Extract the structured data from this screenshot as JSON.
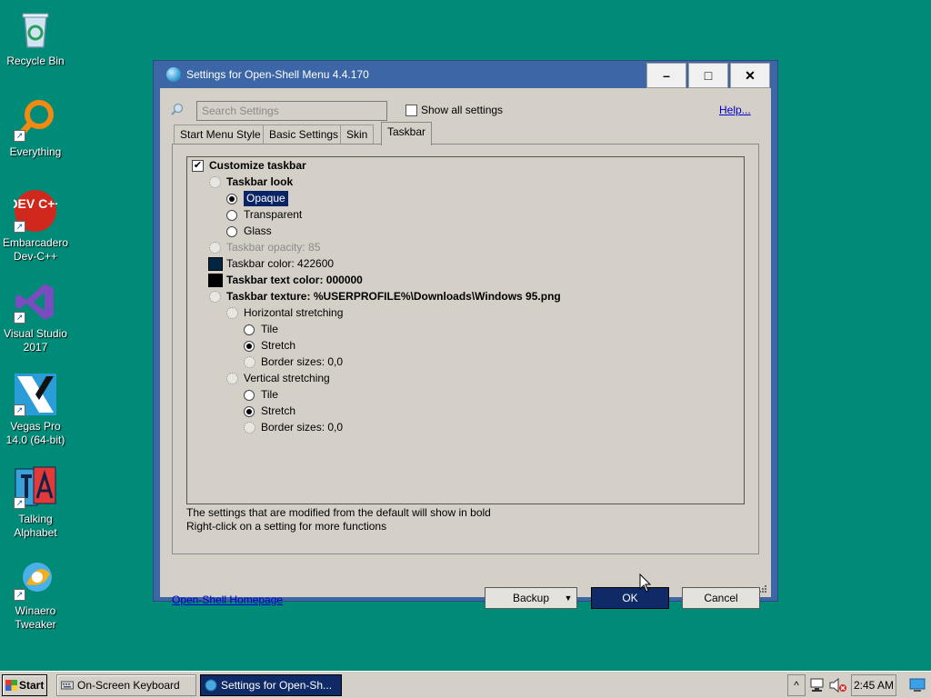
{
  "desktop": {
    "icons": [
      {
        "label": "Recycle Bin"
      },
      {
        "label": "Everything"
      },
      {
        "label": "Embarcadero Dev-C++"
      },
      {
        "label": "Visual Studio 2017"
      },
      {
        "label": "Vegas Pro 14.0 (64-bit)"
      },
      {
        "label": "Talking Alphabet"
      },
      {
        "label": "Winaero Tweaker"
      }
    ],
    "devcpp_text": "DEV C++"
  },
  "dialog": {
    "title": "Settings for Open-Shell Menu 4.4.170",
    "search_placeholder": "Search Settings",
    "show_all_label": "Show all settings",
    "help_label": "Help...",
    "tabs": [
      {
        "label": "Start Menu Style"
      },
      {
        "label": "Basic Settings"
      },
      {
        "label": "Skin"
      },
      {
        "label": "Taskbar"
      }
    ],
    "active_tab": "Taskbar",
    "tree": {
      "customize_taskbar": "Customize taskbar",
      "taskbar_look": "Taskbar look",
      "look_opaque": "Opaque",
      "look_transparent": "Transparent",
      "look_glass": "Glass",
      "taskbar_opacity": "Taskbar opacity: 85",
      "taskbar_color": "Taskbar color: 422600",
      "taskbar_text_color": "Taskbar text color: 000000",
      "taskbar_texture": "Taskbar texture: %USERPROFILE%\\Downloads\\Windows 95.png",
      "horizontal_stretching": "Horizontal stretching",
      "h_tile": "Tile",
      "h_stretch": "Stretch",
      "h_border_sizes": "Border sizes: 0,0",
      "vertical_stretching": "Vertical stretching",
      "v_tile": "Tile",
      "v_stretch": "Stretch",
      "v_border_sizes": "Border sizes: 0,0"
    },
    "swatch_colors": {
      "taskbar_color": "#002642",
      "taskbar_text_color": "#000000"
    },
    "hint_line1": "The settings that are modified from the default will show in bold",
    "hint_line2": "Right-click on a setting for more functions",
    "homepage_label": "Open-Shell Homepage",
    "backup_label": "Backup",
    "ok_label": "OK",
    "cancel_label": "Cancel"
  },
  "taskbar": {
    "start_label": "Start",
    "tasks": [
      {
        "label": "On-Screen Keyboard"
      },
      {
        "label": "Settings for Open-Sh..."
      }
    ],
    "clock": "2:45 AM"
  },
  "colors": {
    "desktop": "#008a78",
    "title_bar": "#3c66a5",
    "selection": "#0a2466"
  }
}
